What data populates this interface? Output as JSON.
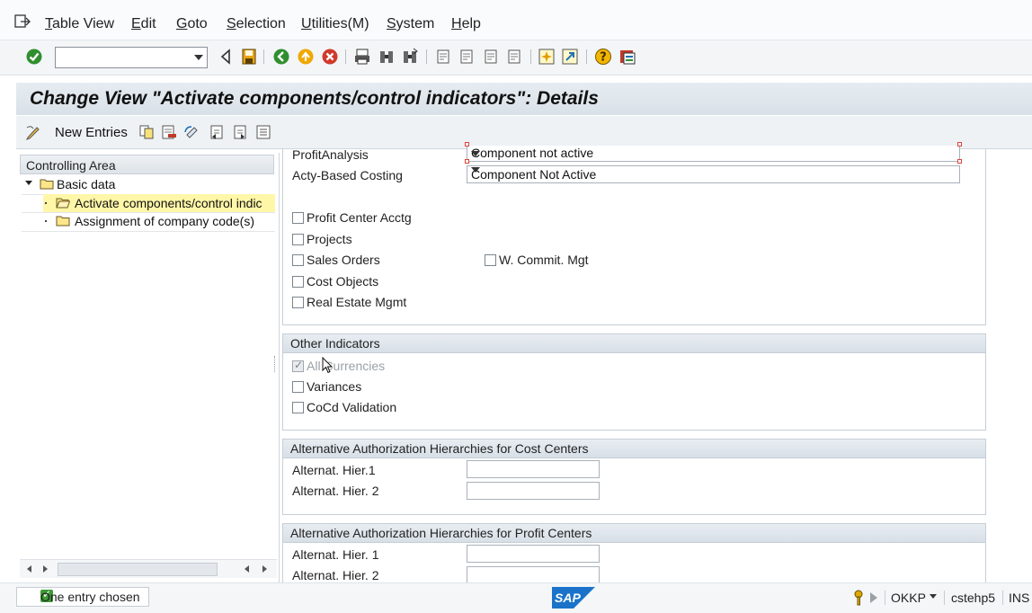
{
  "menu": {
    "items": [
      "Table View",
      "Edit",
      "Goto",
      "Selection",
      "Utilities(M)",
      "System",
      "Help"
    ]
  },
  "toolbar": {
    "command_field_value": "",
    "icons": [
      "enter-icon",
      "back-triangle-icon",
      "save-icon",
      "back-icon",
      "exit-icon",
      "cancel-icon",
      "print-icon",
      "find-icon",
      "find-next-icon",
      "first-page-icon",
      "previous-page-icon",
      "next-page-icon",
      "last-page-icon",
      "create-session-icon",
      "shortcut-icon",
      "help-icon",
      "customize-layout-icon"
    ]
  },
  "title": "Change View \"Activate components/control indicators\": Details",
  "app_toolbar": {
    "new_entries_label": "New Entries"
  },
  "tree": {
    "header": "Controlling Area",
    "items": [
      {
        "label": "Basic data",
        "level": 0,
        "expanded": true
      },
      {
        "label": "Activate components/control indic",
        "level": 1,
        "selected": true
      },
      {
        "label": "Assignment of company code(s)",
        "level": 1,
        "selected": false
      }
    ]
  },
  "components": {
    "profit_analysis_label": "ProfitAnalysis",
    "profit_analysis_value": "Component not active",
    "acty_based_label": "Acty-Based Costing",
    "acty_based_value": "Component Not Active",
    "checkboxes": [
      {
        "label": "Profit Center Acctg",
        "checked": false
      },
      {
        "label": "Projects",
        "checked": false
      },
      {
        "label": "Sales Orders",
        "checked": false
      },
      {
        "label": "Cost Objects",
        "checked": false
      },
      {
        "label": "Real Estate Mgmt",
        "checked": false
      },
      {
        "label": "W. Commit. Mgt",
        "checked": false
      }
    ]
  },
  "other_indicators": {
    "header": "Other Indicators",
    "checkboxes": [
      {
        "label": "All Currencies",
        "checked": true,
        "disabled": true
      },
      {
        "label": "Variances",
        "checked": false
      },
      {
        "label": "CoCd Validation",
        "checked": false
      }
    ]
  },
  "auth_cost_centers": {
    "header": "Alternative Authorization Hierarchies for Cost Centers",
    "hier1_label": "Alternat. Hier.1",
    "hier2_label": "Alternat. Hier. 2",
    "hier1_value": "",
    "hier2_value": ""
  },
  "auth_profit_centers": {
    "header": "Alternative Authorization Hierarchies for Profit Centers",
    "hier1_label": "Alternat. Hier. 1",
    "hier2_label": "Alternat. Hier. 2",
    "hier1_value": "",
    "hier2_value": ""
  },
  "status": {
    "message": "One entry chosen",
    "logo": "SAP",
    "transaction": "OKKP",
    "server": "cstehp5",
    "mode": "INS"
  },
  "colors": {
    "title_bg": "#dde4ea",
    "success_green": "#3d9a36",
    "sap_blue": "#1a73c9",
    "tree_selected": "#fff7a8"
  }
}
